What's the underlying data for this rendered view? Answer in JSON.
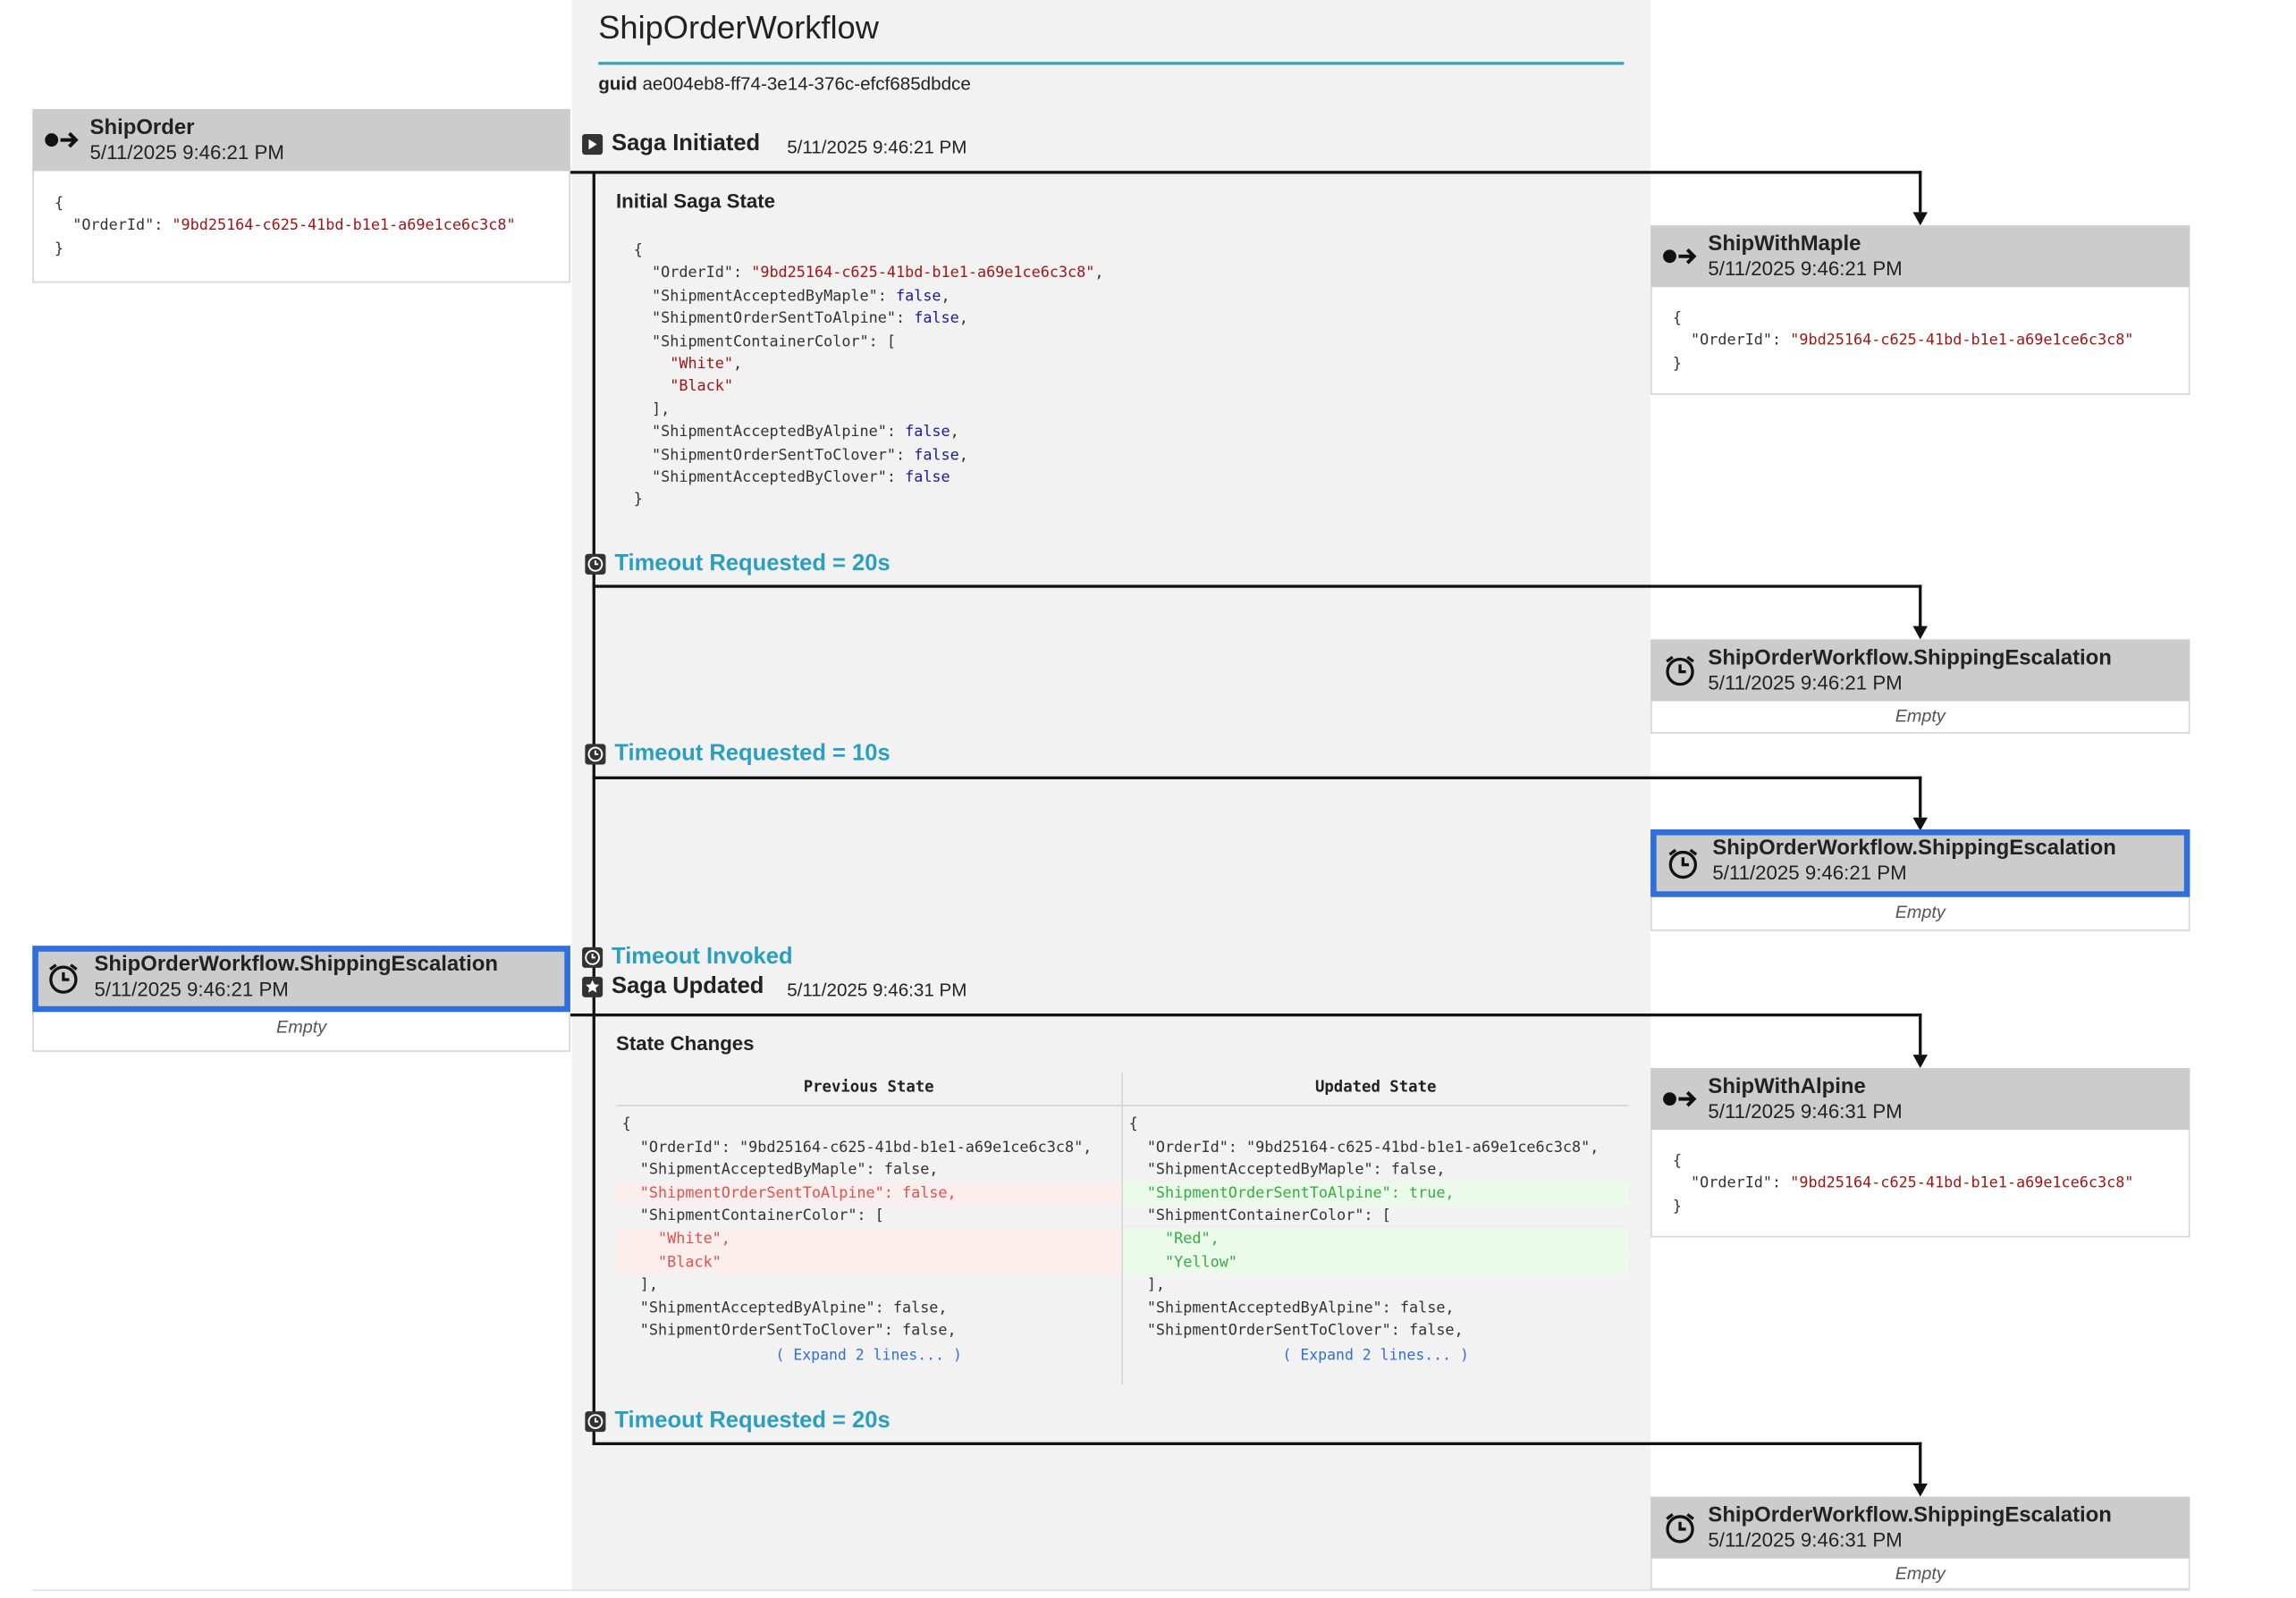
{
  "saga": {
    "title": "ShipOrderWorkflow",
    "guid_label": "guid",
    "guid": "ae004eb8-ff74-3e14-376c-efcf685dbdce"
  },
  "incoming": [
    {
      "name": "ShipOrder",
      "time": "5/11/2025 9:46:21 PM",
      "icon": "message-send-icon",
      "body": [
        "{",
        "  \"OrderId\": \"9bd25164-c625-41bd-b1e1-a69e1ce6c3c8\"",
        "}"
      ]
    },
    {
      "name": "ShipOrderWorkflow.ShippingEscalation",
      "time": "5/11/2025 9:46:21 PM",
      "icon": "alarm-clock-icon",
      "empty": "Empty",
      "highlighted": true
    }
  ],
  "events": {
    "initiated": {
      "label": "Saga Initiated",
      "time": "5/11/2025 9:46:21 PM",
      "icon": "play-icon"
    },
    "initial_state_title": "Initial Saga State",
    "initial_state": [
      "{",
      "  \"OrderId\": \"9bd25164-c625-41bd-b1e1-a69e1ce6c3c8\",",
      "  \"ShipmentAcceptedByMaple\": false,",
      "  \"ShipmentOrderSentToAlpine\": false,",
      "  \"ShipmentContainerColor\": [",
      "    \"White\",",
      "    \"Black\"",
      "  ],",
      "  \"ShipmentAcceptedByAlpine\": false,",
      "  \"ShipmentOrderSentToClover\": false,",
      "  \"ShipmentAcceptedByClover\": false",
      "}"
    ],
    "timeout1": "Timeout Requested = 20s",
    "timeout2": "Timeout Requested = 10s",
    "timeout_invoked": "Timeout Invoked",
    "updated": {
      "label": "Saga Updated",
      "time": "5/11/2025 9:46:31 PM",
      "icon": "star-icon"
    },
    "timeout3": "Timeout Requested = 20s"
  },
  "state_changes": {
    "title": "State Changes",
    "prev_header": "Previous State",
    "upd_header": "Updated State",
    "prev": [
      {
        "t": "{",
        "k": ""
      },
      {
        "t": "  \"OrderId\": \"9bd25164-c625-41bd-b1e1-a69e1ce6c3c8\",",
        "k": ""
      },
      {
        "t": "  \"ShipmentAcceptedByMaple\": false,",
        "k": ""
      },
      {
        "t": "  \"ShipmentOrderSentToAlpine\": false,",
        "k": "del"
      },
      {
        "t": "  \"ShipmentContainerColor\": [",
        "k": ""
      },
      {
        "t": "    \"White\",",
        "k": "del"
      },
      {
        "t": "    \"Black\"",
        "k": "del"
      },
      {
        "t": "  ],",
        "k": ""
      },
      {
        "t": "  \"ShipmentAcceptedByAlpine\": false,",
        "k": ""
      },
      {
        "t": "  \"ShipmentOrderSentToClover\": false,",
        "k": ""
      }
    ],
    "upd": [
      {
        "t": "{",
        "k": ""
      },
      {
        "t": "  \"OrderId\": \"9bd25164-c625-41bd-b1e1-a69e1ce6c3c8\",",
        "k": ""
      },
      {
        "t": "  \"ShipmentAcceptedByMaple\": false,",
        "k": ""
      },
      {
        "t": "  \"ShipmentOrderSentToAlpine\": true,",
        "k": "add"
      },
      {
        "t": "  \"ShipmentContainerColor\": [",
        "k": ""
      },
      {
        "t": "    \"Red\",",
        "k": "add"
      },
      {
        "t": "    \"Yellow\"",
        "k": "add"
      },
      {
        "t": "  ],",
        "k": ""
      },
      {
        "t": "  \"ShipmentAcceptedByAlpine\": false,",
        "k": ""
      },
      {
        "t": "  \"ShipmentOrderSentToClover\": false,",
        "k": ""
      }
    ],
    "expand_prev": "( Expand 2 lines... )",
    "expand_upd": "( Expand 2 lines... )"
  },
  "outgoing": [
    {
      "name": "ShipWithMaple",
      "time": "5/11/2025 9:46:21 PM",
      "icon": "message-send-icon",
      "body": [
        "{",
        "  \"OrderId\": \"9bd25164-c625-41bd-b1e1-a69e1ce6c3c8\"",
        "}"
      ]
    },
    {
      "name": "ShipOrderWorkflow.ShippingEscalation",
      "time": "5/11/2025 9:46:21 PM",
      "icon": "alarm-clock-icon",
      "empty": "Empty"
    },
    {
      "name": "ShipOrderWorkflow.ShippingEscalation",
      "time": "5/11/2025 9:46:21 PM",
      "icon": "alarm-clock-icon",
      "empty": "Empty",
      "highlighted": true
    },
    {
      "name": "ShipWithAlpine",
      "time": "5/11/2025 9:46:31 PM",
      "icon": "message-send-icon",
      "body": [
        "{",
        "  \"OrderId\": \"9bd25164-c625-41bd-b1e1-a69e1ce6c3c8\"",
        "}"
      ]
    },
    {
      "name": "ShipOrderWorkflow.ShippingEscalation",
      "time": "5/11/2025 9:46:31 PM",
      "icon": "alarm-clock-icon",
      "empty": "Empty"
    }
  ]
}
